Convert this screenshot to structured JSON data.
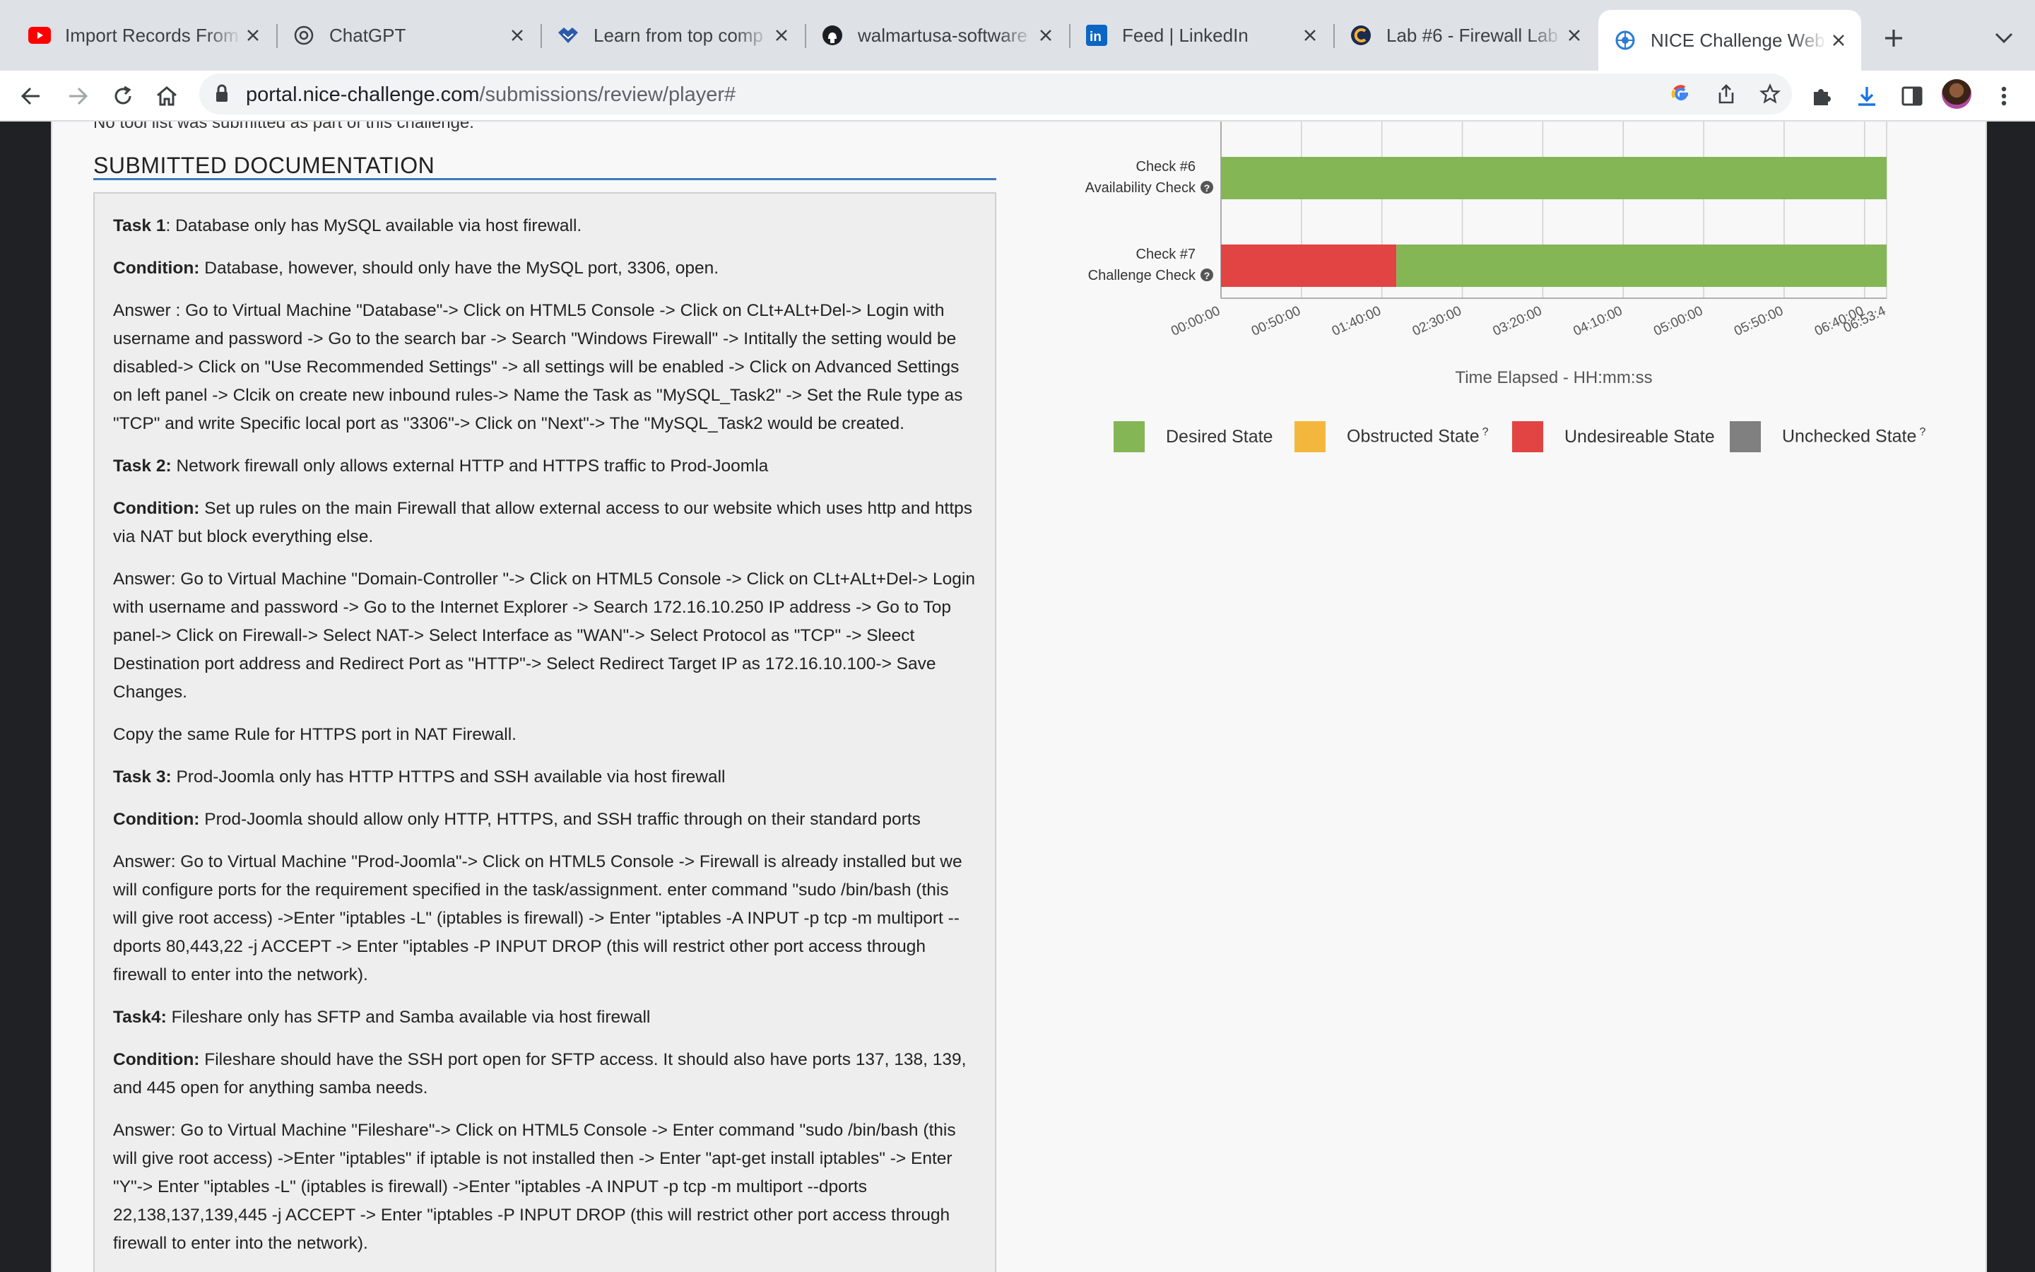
{
  "browser": {
    "tabs": [
      {
        "title": "Import Records From",
        "icon": "youtube-icon",
        "active": false
      },
      {
        "title": "ChatGPT",
        "icon": "chatgpt-icon",
        "active": false
      },
      {
        "title": "Learn from top comp",
        "icon": "handshake-icon",
        "active": false
      },
      {
        "title": "walmartusa-software",
        "icon": "github-icon",
        "active": false
      },
      {
        "title": "Feed | LinkedIn",
        "icon": "linkedin-icon",
        "active": false
      },
      {
        "title": "Lab #6 - Firewall Lab",
        "icon": "clog-icon",
        "active": false
      },
      {
        "title": "NICE Challenge Web",
        "icon": "nice-icon",
        "active": true
      }
    ],
    "url_host": "portal.nice-challenge.com",
    "url_path": "/submissions/review/player#"
  },
  "page": {
    "no_tool_text": "No tool list was submitted as part of this challenge.",
    "doc_heading": "SUBMITTED DOCUMENTATION",
    "paragraphs": [
      {
        "label": "Task 1",
        "sep": ": ",
        "text": "Database only has MySQL available via host firewall."
      },
      {
        "label": "Condition:",
        "sep": " ",
        "text": "Database, however, should only have the MySQL port, 3306, open."
      },
      {
        "label": "",
        "sep": "",
        "text": "Answer : Go to Virtual Machine \"Database\"-> Click on HTML5 Console -> Click on CLt+ALt+Del-> Login with username and password -> Go to the search bar -> Search \"Windows Firewall\" -> Intitally the setting would be disabled-> Click on \"Use Recommended Settings\" -> all settings will be enabled -> Click on Advanced Settings on left panel -> Clcik on create new inbound rules-> Name the Task as \"MySQL_Task2\" ->  Set the Rule type as \"TCP\" and write Specific local port as \"3306\"-> Click on \"Next\"-> The \"MySQL_Task2 would be created."
      },
      {
        "label": "Task 2:",
        "sep": " ",
        "text": "Network firewall only allows external HTTP and HTTPS traffic to Prod-Joomla"
      },
      {
        "label": "Condition:",
        "sep": " ",
        "text": "Set up rules on the main Firewall that allow external access to our website which uses http and https via NAT but block everything else."
      },
      {
        "label": "",
        "sep": "",
        "text": "Answer: Go to Virtual Machine \"Domain-Controller \"-> Click on HTML5 Console -> Click on CLt+ALt+Del-> Login with username and password -> Go to the Internet Explorer -> Search 172.16.10.250 IP address -> Go to Top panel-> Click on Firewall-> Select NAT-> Select Interface as \"WAN\"-> Select Protocol as \"TCP\" -> Sleect Destination port address and Redirect Port as  \"HTTP\"-> Select Redirect Target IP as 172.16.10.100-> Save Changes."
      },
      {
        "label": "",
        "sep": "",
        "text": "Copy the same Rule for HTTPS port in NAT Firewall."
      },
      {
        "label": "Task 3:",
        "sep": " ",
        "text": "Prod-Joomla only has HTTP HTTPS and SSH available via host firewall"
      },
      {
        "label": "Condition:",
        "sep": " ",
        "text": "Prod-Joomla should allow only HTTP, HTTPS, and SSH traffic through on their standard ports"
      },
      {
        "label": "",
        "sep": "",
        "text": "Answer: Go to Virtual Machine \"Prod-Joomla\"-> Click on HTML5 Console -> Firewall is already installed but we will configure ports for the requirement specified in the task/assignment. enter command  \"sudo /bin/bash (this will give root access) ->Enter \"iptables -L\" (iptables is firewall) -> Enter \"iptables -A INPUT -p tcp -m multiport --dports 80,443,22 -j ACCEPT -> Enter \"iptables -P INPUT DROP (this will restrict other port access through firewall to enter into the network)."
      },
      {
        "label": "Task4:",
        "sep": " ",
        "text": "Fileshare only has SFTP and Samba available via host firewall"
      },
      {
        "label": "Condition:",
        "sep": " ",
        "text": "Fileshare should have the SSH port open for SFTP access. It should also have ports 137, 138, 139, and 445 open for anything samba needs."
      },
      {
        "label": "",
        "sep": "",
        "text": "Answer: Go to Virtual Machine \"Fileshare\"-> Click on HTML5 Console -> Enter command  \"sudo /bin/bash (this will give root access) ->Enter \"iptables\" if iptable is not installed then  -> Enter \"apt-get install iptables\"  -> Enter \"Y\"-> Enter \"iptables -L\" (iptables is firewall) ->Enter \"iptables -A INPUT -p tcp -m multiport --dports 22,138,137,139,445 -j ACCEPT ->  Enter \"iptables -P INPUT DROP (this will restrict other port access through firewall to enter into the network)."
      }
    ]
  },
  "colors": {
    "desired": "#84b656",
    "obstructed": "#f4b73e",
    "undesirable": "#e14442",
    "unchecked": "#808080"
  },
  "chart_data": {
    "type": "bar",
    "orientation": "horizontal-timeline",
    "xlabel": "Time Elapsed - HH:mm:ss",
    "x_ticks": [
      "00:00:00",
      "00:50:00",
      "01:40:00",
      "02:30:00",
      "03:20:00",
      "04:10:00",
      "05:00:00",
      "05:50:00",
      "06:40:00",
      "06:53:4"
    ],
    "x_tick_minutes": [
      0,
      50,
      100,
      150,
      200,
      250,
      300,
      350,
      400,
      413.7
    ],
    "xlim_minutes": [
      0,
      413.7
    ],
    "grid": true,
    "rows": [
      {
        "check": "Check #6",
        "name": "Availability Check",
        "segments": [
          {
            "state": "desired",
            "start_min": 0,
            "end_min": 413.7
          }
        ]
      },
      {
        "check": "Check #7",
        "name": "Challenge Check",
        "segments": [
          {
            "state": "undesirable",
            "start_min": 0,
            "end_min": 109
          },
          {
            "state": "desired",
            "start_min": 109,
            "end_min": 413.7
          }
        ]
      }
    ],
    "legend": [
      {
        "key": "desired",
        "label": "Desired State",
        "help": ""
      },
      {
        "key": "obstructed",
        "label": "Obstructed State",
        "help": "?"
      },
      {
        "key": "undesirable",
        "label": "Undesireable State",
        "help": ""
      },
      {
        "key": "unchecked",
        "label": "Unchecked State",
        "help": "?"
      }
    ]
  }
}
